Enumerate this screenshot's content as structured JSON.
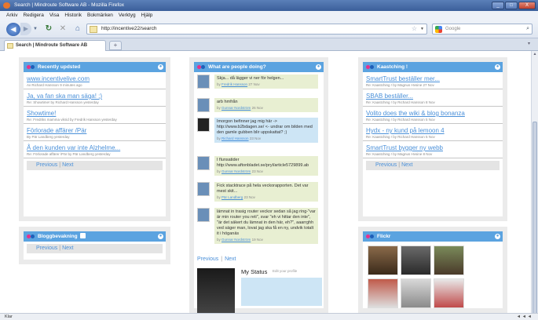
{
  "window": {
    "title": "Search | Mindroute Software AB - Mozilla Firefox",
    "buttons": [
      "_",
      "□",
      "X"
    ]
  },
  "menu": [
    "Arkiv",
    "Redigera",
    "Visa",
    "Historik",
    "Bokmärken",
    "Verktyg",
    "Hjälp"
  ],
  "nav": {
    "url": "http://incentive22/search",
    "search_placeholder": "Google"
  },
  "tabs": [
    {
      "label": "Search | Mindroute Software AB"
    }
  ],
  "new_tab_label": "+",
  "widgets": {
    "recently_updated": {
      "title": "Recently updsted",
      "items": [
        {
          "title": "www.incentivelive.com",
          "meta": "Av Richard Hansson 9 minutes ago"
        },
        {
          "title": "Ja, va fan ska man säga! ;)",
          "meta": "Re: Showtime! by Richard Hansson yesterday"
        },
        {
          "title": "Showtime!",
          "meta": "Re: Fredriks mamma vikrid by Fredrik Hansson yesterday"
        },
        {
          "title": "Förlorade affärer /Pär",
          "meta": "By Pär Landberg yesterday"
        },
        {
          "title": "Å den kunden var inte Alzhelme...",
          "meta": "Re: Förlorade affärer /Pär by Pär Landberg yesterday"
        }
      ],
      "prev": "Previous",
      "next": "Next"
    },
    "bloggbevakning": {
      "title": "Bloggbevakning",
      "prev": "Previous",
      "next": "Next"
    },
    "people": {
      "title": "What are people doing?",
      "posts": [
        {
          "text": "Skja... då lägger vi ner för helgen...",
          "author": "Fredrik Hansson",
          "date": "27 Nov",
          "dark": false,
          "blue": false
        },
        {
          "text": "arb hmfrån",
          "author": "Gunnar Nordström",
          "date": "26 Nov",
          "dark": false,
          "blue": false
        },
        {
          "text": "Imorgon befinner jag mig här -> http://www.b2bdagen.se/ <- undrar om bilden med den gamle gubben blir uppskattat? ;)",
          "author": "Richard Hansson",
          "date": "23 Nov",
          "dark": true,
          "blue": true
        },
        {
          "text": "I flunsatider http://www.aftonbladet.se/pryl/article5729899.ab",
          "author": "Gunnar Nordström",
          "date": "23 Nov",
          "dark": false,
          "blue": false
        },
        {
          "text": "Fick stacktrace på hela veckorapporten. Det var mest skit...",
          "author": "Pär Landberg",
          "date": "23 Nov",
          "dark": false,
          "blue": false
        },
        {
          "text": "lämnat in trasig router veckor sedan så jag ring-\"var är min router you reti\", svar \"eh vi hittar den inte\", \"är det säkert du lämnat in den här, eh?\", aaarrghh ved säger man, lovat jag ska få en ny, undvik totalt it i höganäs",
          "author": "Gunnar Nordström",
          "date": "19 Nov",
          "dark": false,
          "blue": false
        }
      ],
      "prev": "Previous",
      "next": "Next",
      "status_title": "My Status",
      "status_edit": "Edit your profile",
      "by": "by"
    },
    "kaastching": {
      "title": "Kaastching !",
      "items": [
        {
          "title": "SmartTrust beställer mer...",
          "meta": "Re: Kaastching ! by Magnus Hvsine 27 Nov"
        },
        {
          "title": "SBAB beställer...",
          "meta": "Re: Kaastching ! by Richard Hansson 8 Nov"
        },
        {
          "title": "Volito does the wiki & blog bonanza",
          "meta": "Re: Kaastching ! by Richard Hansson 5 Nov"
        },
        {
          "title": "Hydx - ny kund på lemoon 4",
          "meta": "Re: Kaastching ! by Richard Hansson 5 Nov"
        },
        {
          "title": "SmartTrust bygger ny webb",
          "meta": "Re: Kaastching ! by Magnus Hvsine 8 Nov"
        }
      ],
      "prev": "Previous",
      "next": "Next"
    },
    "flickr": {
      "title": "Flickr"
    }
  },
  "statusbar": {
    "left": "Klar",
    "right": "◄ ◄ ◄"
  }
}
